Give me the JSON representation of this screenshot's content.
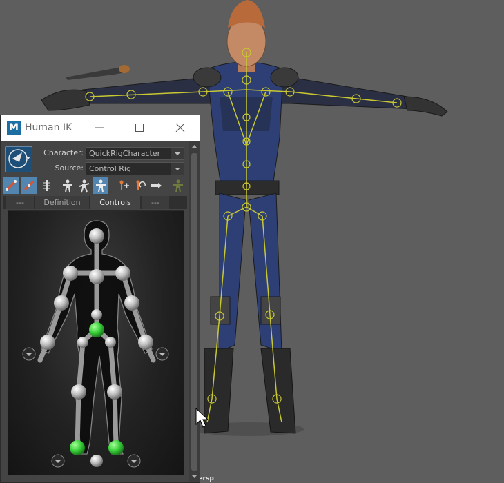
{
  "viewport": {
    "camera_label": "persp",
    "background_color": "#5e5e5e",
    "skeleton_color": "#c8c832",
    "suit_color": "#2d3f75"
  },
  "window": {
    "title": "Human IK",
    "logo_letter": "M",
    "buttons": [
      "minimize-icon",
      "maximize-icon",
      "close-icon"
    ]
  },
  "character_row": {
    "character_label": "Character:",
    "character_value": "QuickRigCharacter",
    "source_label": "Source:",
    "source_value": "Control Rig"
  },
  "toolbar": {
    "icons": [
      "fk-ik-toggle-icon",
      "full-body-ik-icon",
      "spine-icon",
      "figure-select-icon",
      "figure-pin-icon",
      "figure-body-icon",
      "move-pin-icon",
      "rotate-pin-icon",
      "key-icon",
      "stance-icon"
    ],
    "active_color": "#5285b0"
  },
  "tabs": [
    {
      "label": "---"
    },
    {
      "label": "Definition"
    },
    {
      "label": "Controls"
    },
    {
      "label": "---"
    }
  ],
  "controls_panel": {
    "selected_effector_color": "#3cd13c",
    "effector_color": "#c9c9c9",
    "expand_arrows": [
      "left-hand-expand-icon",
      "right-hand-expand-icon",
      "left-foot-expand-icon",
      "right-foot-expand-icon"
    ]
  }
}
